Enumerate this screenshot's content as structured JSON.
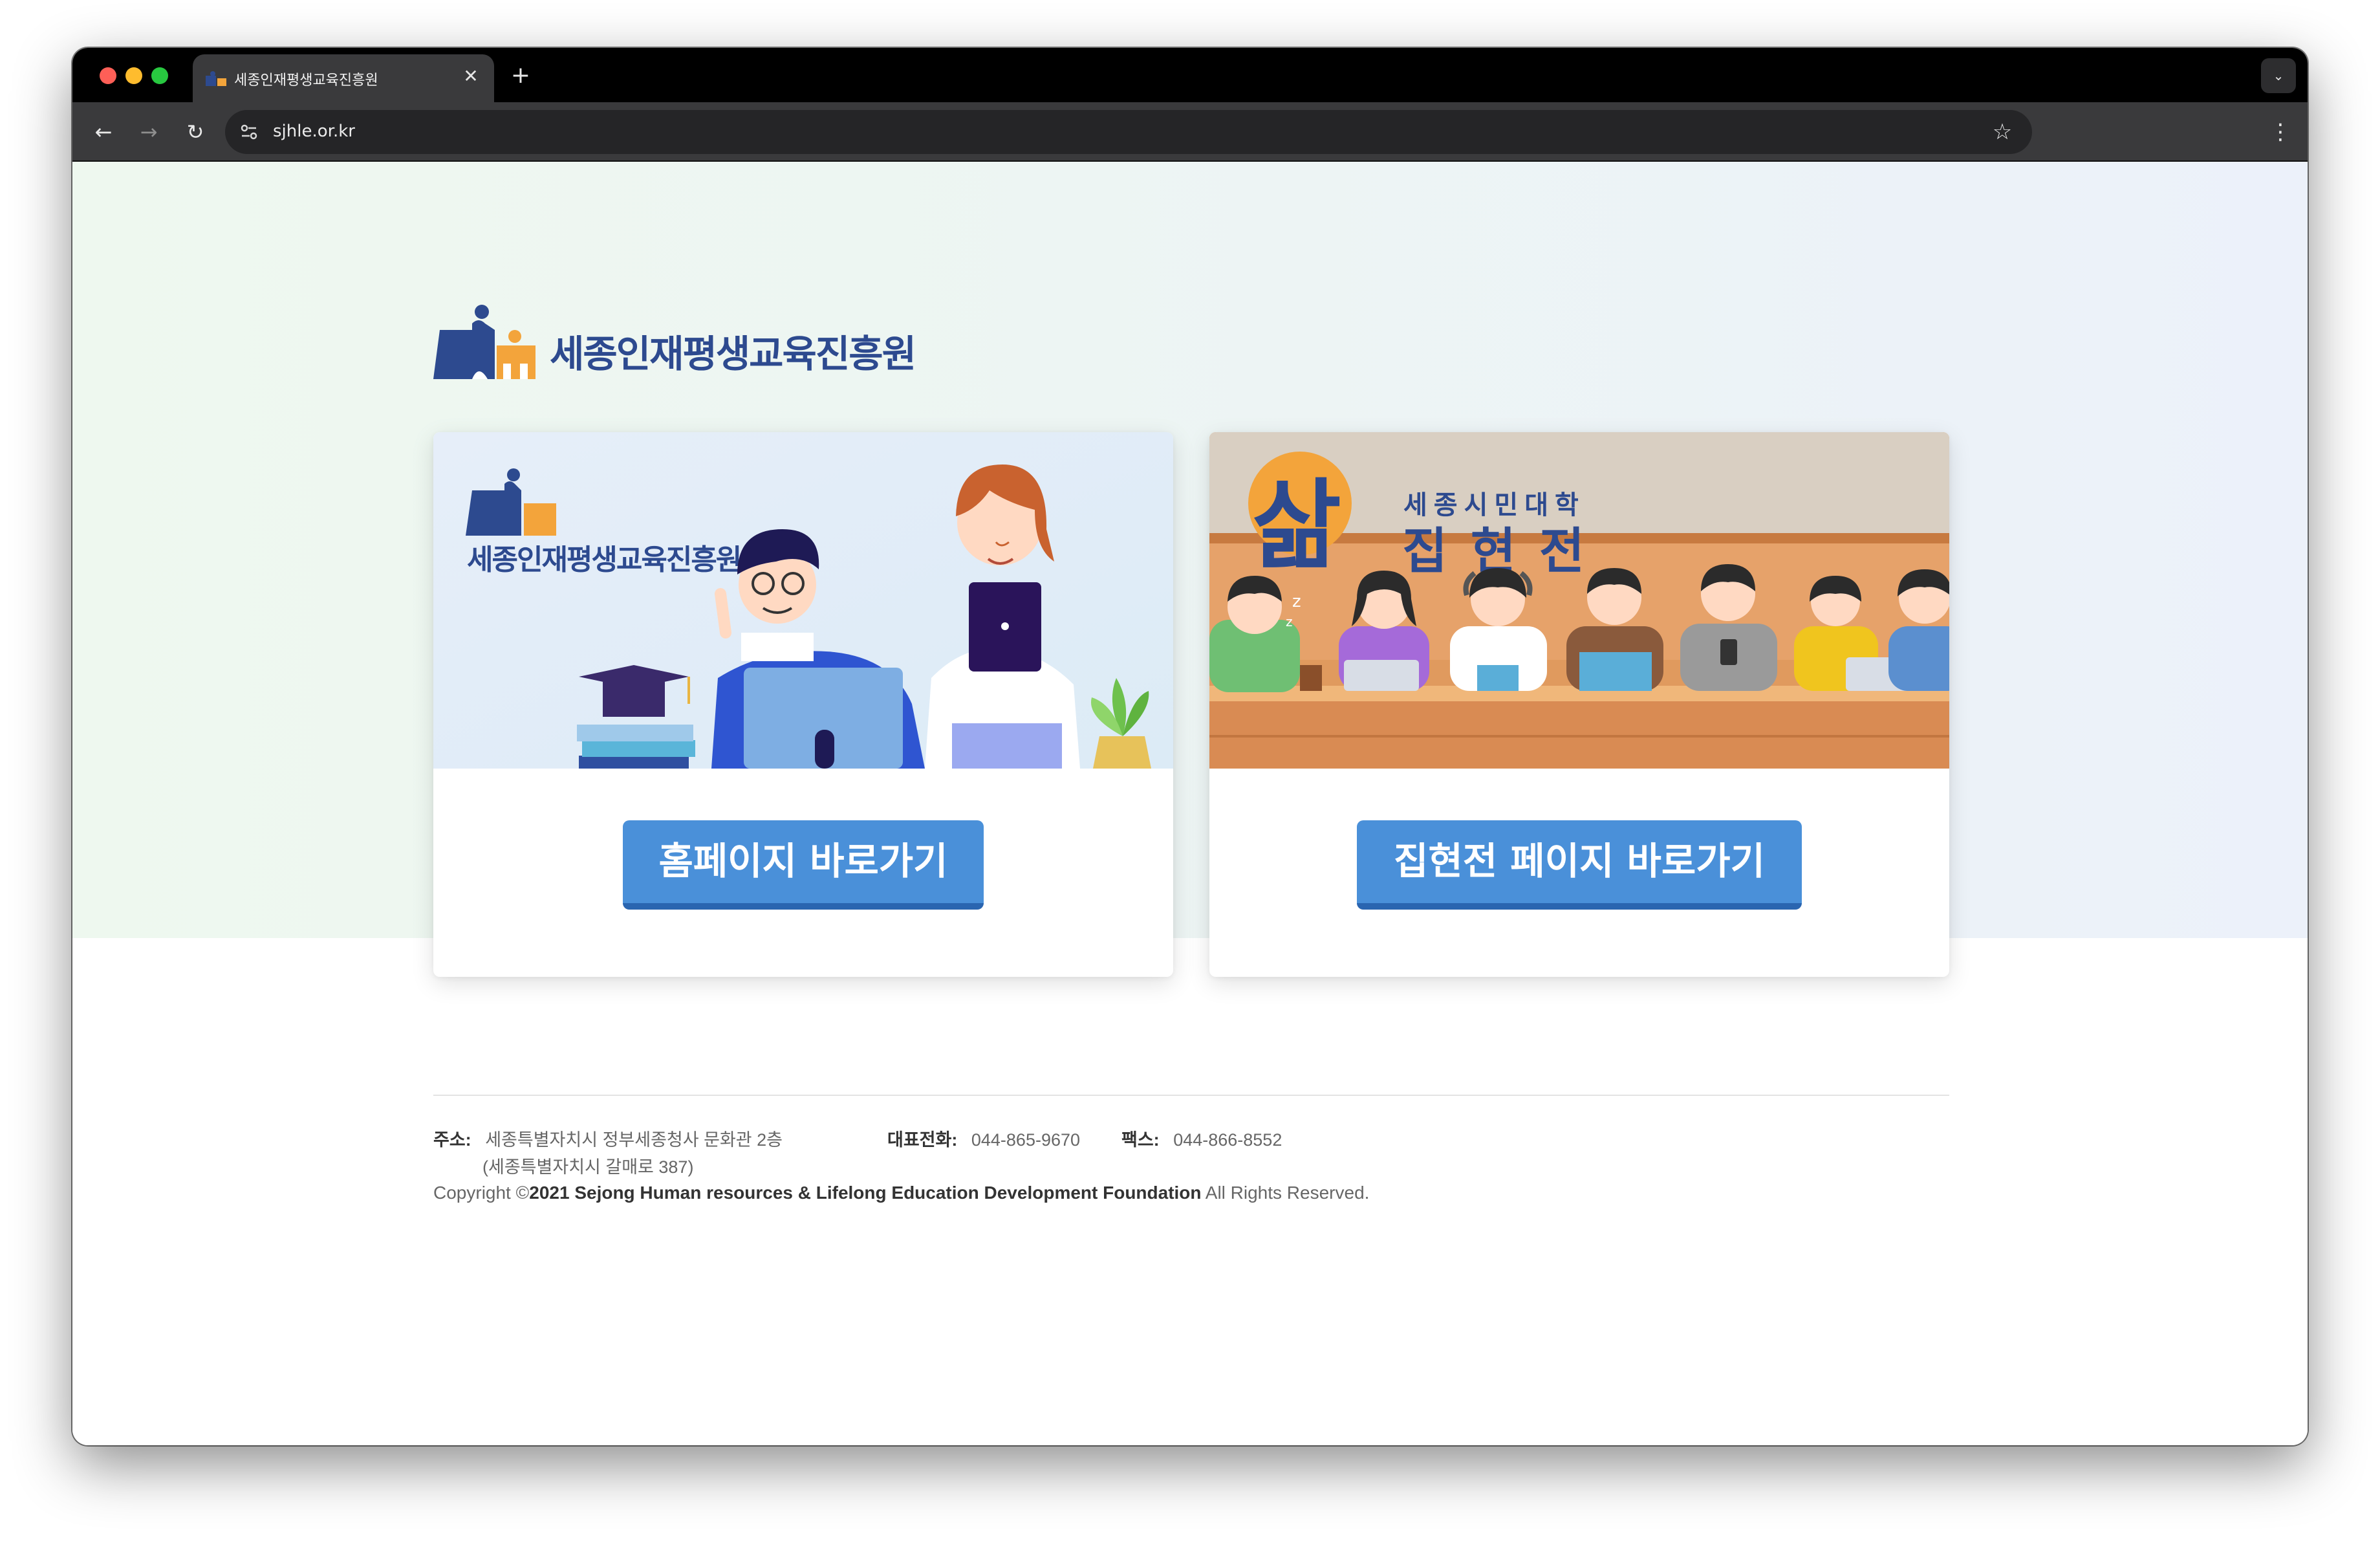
{
  "browser": {
    "tab_title": "세종인재평생교육진흥원",
    "tab_close": "✕",
    "new_tab": "+",
    "tab_menu": "⌄",
    "url": "sjhle.or.kr",
    "back": "←",
    "forward": "→",
    "reload": "↻",
    "bookmark": "☆",
    "menu": "⋮"
  },
  "header": {
    "logo_text": "세종인재평생교육진흥원"
  },
  "cards": {
    "home": {
      "illustration_logo_text": "세종인재평생교육진흥원",
      "button_label": "홈페이지 바로가기"
    },
    "jiphyeonjeon": {
      "illustration_big_char": "삶",
      "illustration_subtitle": "세종시민대학",
      "illustration_title": "집현전",
      "button_label": "집현전 페이지 바로가기"
    }
  },
  "footer": {
    "address_label": "주소:",
    "address_line1": "세종특별자치시 정부세종청사 문화관 2층",
    "address_line2": "(세종특별자치시 갈매로 387)",
    "phone_label": "대표전화:",
    "phone_value": "044-865-9670",
    "fax_label": "팩스:",
    "fax_value": "044-866-8552",
    "copyright_prefix": "Copyright ©",
    "copyright_org": "2021 Sejong Human resources & Lifelong Education Development Foundation",
    "copyright_suffix": " All Rights Reserved."
  },
  "colors": {
    "button": "#4a90d9",
    "button_shadow": "#2a65b0",
    "logo_blue": "#2d4a8f",
    "logo_orange": "#f3a43b"
  }
}
